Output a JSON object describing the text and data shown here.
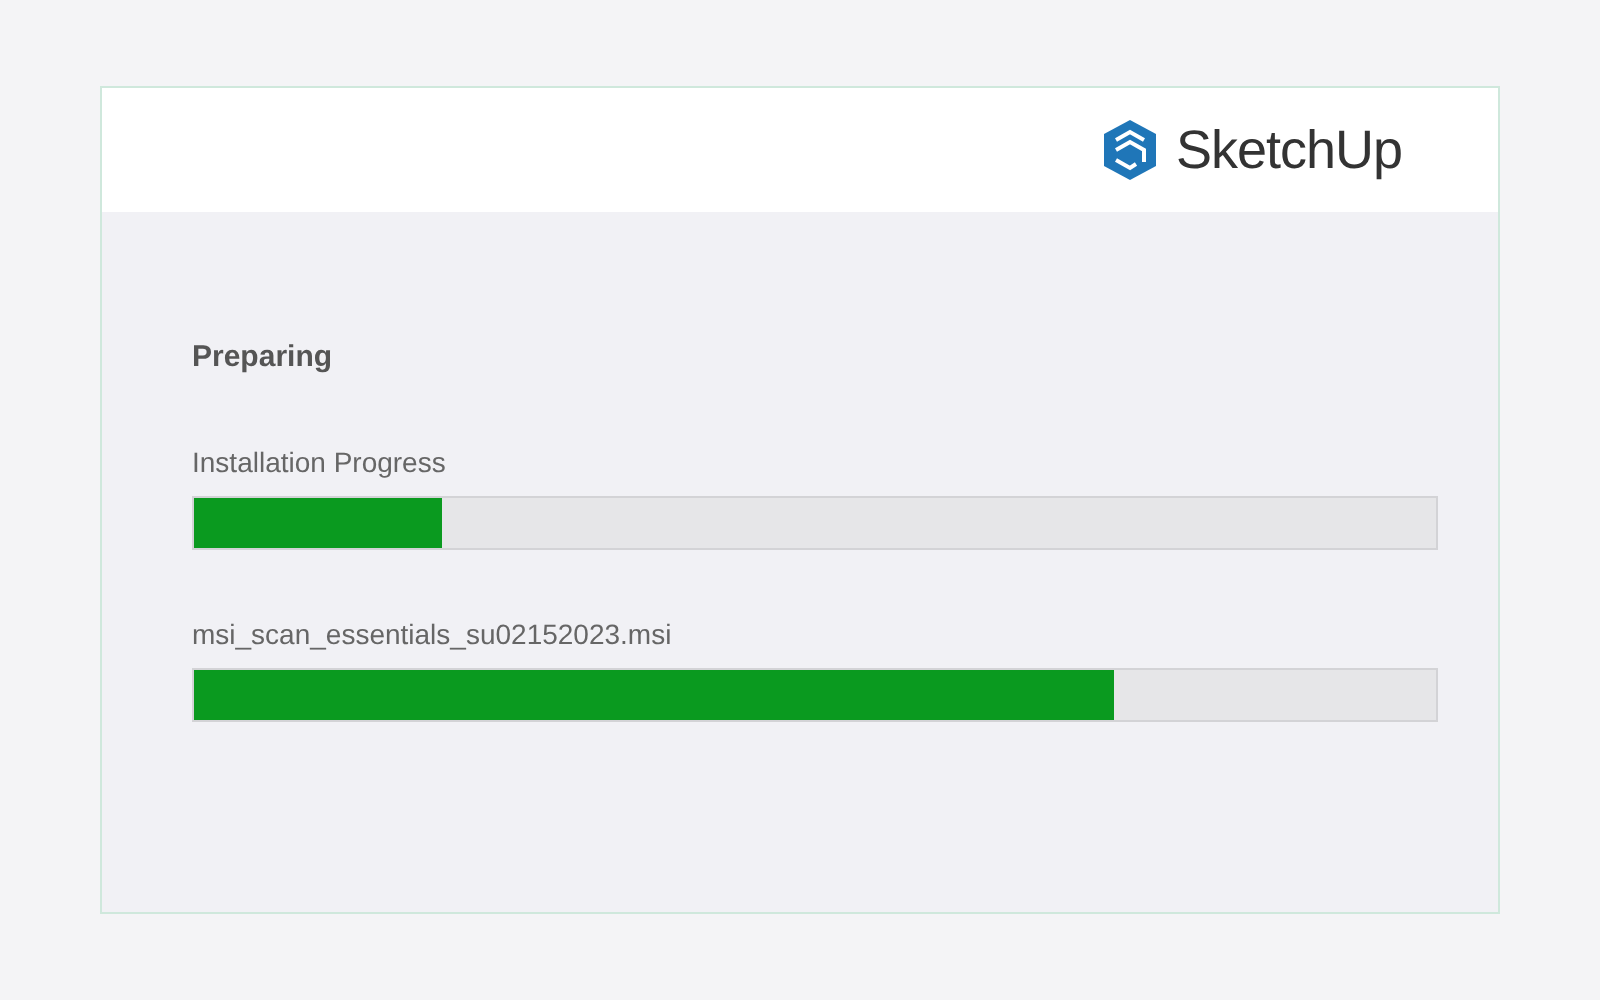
{
  "header": {
    "logo_text": "SketchUp"
  },
  "status": "Preparing",
  "progress": [
    {
      "label": "Installation Progress",
      "level": 0.2
    },
    {
      "label": "msi_scan_essentials_su02152023.msi",
      "level": 0.74
    }
  ]
}
